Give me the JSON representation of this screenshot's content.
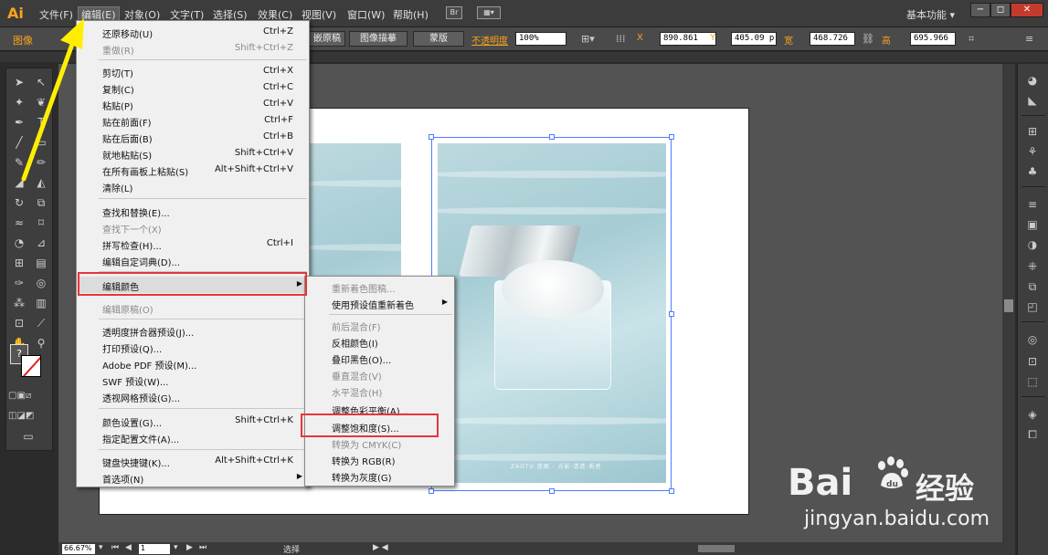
{
  "app": {
    "logo": "Ai",
    "workspace": "基本功能",
    "menus": [
      "文件(F)",
      "编辑(E)",
      "对象(O)",
      "文字(T)",
      "选择(S)",
      "效果(C)",
      "视图(V)",
      "窗口(W)",
      "帮助(H)"
    ],
    "active_menu": "编辑(E)",
    "window_buttons": [
      "−",
      "◻",
      "✕"
    ],
    "bridge_label": "Br"
  },
  "control_bar": {
    "label": "图像",
    "buttons": [
      "嵌原稿",
      "图像描摹",
      "蒙版"
    ],
    "opacity_label": "不透明度",
    "opacity_value": "100%",
    "x_label": "X",
    "x_value": "890.861",
    "y_label": "Y",
    "y_value": "405.09 p",
    "w_label": "宽",
    "w_value": "468.726",
    "h_label": "高",
    "h_value": "695.966"
  },
  "status_bar": {
    "zoom": "66.67%",
    "page": "1",
    "mode": "选择"
  },
  "artboard": {
    "caption": "ZAOTU 造图  ·  光影·清透·质感"
  },
  "edit_menu": {
    "items": [
      {
        "label": "还原移动(U)",
        "shortcut": "Ctrl+Z"
      },
      {
        "label": "重做(R)",
        "shortcut": "Shift+Ctrl+Z",
        "disabled": true
      },
      {
        "label": "剪切(T)",
        "shortcut": "Ctrl+X"
      },
      {
        "label": "复制(C)",
        "shortcut": "Ctrl+C"
      },
      {
        "label": "粘贴(P)",
        "shortcut": "Ctrl+V"
      },
      {
        "label": "贴在前面(F)",
        "shortcut": "Ctrl+F"
      },
      {
        "label": "贴在后面(B)",
        "shortcut": "Ctrl+B"
      },
      {
        "label": "就地粘贴(S)",
        "shortcut": "Shift+Ctrl+V"
      },
      {
        "label": "在所有画板上粘贴(S)",
        "shortcut": "Alt+Shift+Ctrl+V"
      },
      {
        "label": "清除(L)",
        "shortcut": ""
      },
      {
        "label": "查找和替换(E)...",
        "shortcut": ""
      },
      {
        "label": "查找下一个(X)",
        "shortcut": "",
        "disabled": true
      },
      {
        "label": "拼写检查(H)...",
        "shortcut": "Ctrl+I"
      },
      {
        "label": "编辑自定词典(D)...",
        "shortcut": ""
      },
      {
        "label": "编辑颜色",
        "shortcut": "",
        "submenu": true
      },
      {
        "label": "编辑原稿(O)",
        "shortcut": "",
        "disabled": true
      },
      {
        "label": "透明度拼合器预设(J)...",
        "shortcut": ""
      },
      {
        "label": "打印预设(Q)...",
        "shortcut": ""
      },
      {
        "label": "Adobe PDF 预设(M)...",
        "shortcut": ""
      },
      {
        "label": "SWF 预设(W)...",
        "shortcut": ""
      },
      {
        "label": "透视网格预设(G)...",
        "shortcut": ""
      },
      {
        "label": "颜色设置(G)...",
        "shortcut": "Shift+Ctrl+K"
      },
      {
        "label": "指定配置文件(A)...",
        "shortcut": ""
      },
      {
        "label": "键盘快捷键(K)...",
        "shortcut": "Alt+Shift+Ctrl+K"
      },
      {
        "label": "首选项(N)",
        "shortcut": "",
        "submenu": true
      }
    ]
  },
  "color_submenu": {
    "items": [
      {
        "label": "重新着色图稿...",
        "disabled": true
      },
      {
        "label": "使用预设值重新着色",
        "submenu": true
      },
      {
        "label": "前后混合(F)",
        "disabled": true
      },
      {
        "label": "反相颜色(I)"
      },
      {
        "label": "叠印黑色(O)..."
      },
      {
        "label": "垂直混合(V)",
        "disabled": true
      },
      {
        "label": "水平混合(H)",
        "disabled": true
      },
      {
        "label": "调整色彩平衡(A)..."
      },
      {
        "label": "调整饱和度(S)..."
      },
      {
        "label": "转换为 CMYK(C)",
        "disabled": true
      },
      {
        "label": "转换为 RGB(R)"
      },
      {
        "label": "转换为灰度(G)"
      }
    ]
  },
  "watermark": {
    "brand": "Bai",
    "brand2": "经验",
    "url": "jingyan.baidu.com"
  },
  "colors": {
    "accent": "#f7a31c",
    "highlight_box": "#e8353a",
    "arrow": "#ffee00",
    "selection": "#4f7cff"
  }
}
